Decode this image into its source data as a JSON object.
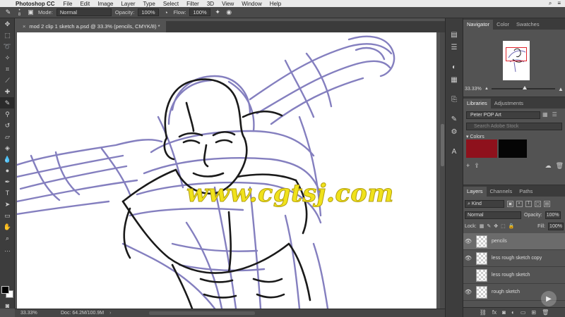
{
  "menubar": {
    "app": "Photoshop CC",
    "items": [
      "File",
      "Edit",
      "Image",
      "Layer",
      "Type",
      "Select",
      "Filter",
      "3D",
      "View",
      "Window",
      "Help"
    ]
  },
  "options": {
    "brush_size": "8",
    "mode_label": "Mode:",
    "mode_value": "Normal",
    "opacity_label": "Opacity:",
    "opacity_value": "100%",
    "flow_label": "Flow:",
    "flow_value": "100%"
  },
  "document": {
    "tab_title": "mod 2 clip 1 sketch a.psd @ 33.3% (pencils, CMYK/8) *",
    "close_glyph": "×",
    "watermark": "www.cgtsj.com"
  },
  "status": {
    "zoom": "33.33%",
    "doc": "Doc: 64.2M/100.9M",
    "arrow": "›"
  },
  "navigator": {
    "tabs": [
      "Navigator",
      "Color",
      "Swatches"
    ],
    "zoom": "33.33%",
    "slider_level": 0.52
  },
  "libraries": {
    "tabs": [
      "Libraries",
      "Adjustments"
    ],
    "library_name": "Peter POP Art",
    "search_placeholder": "Search Adobe Stock",
    "colors_heading": "Colors",
    "swatches": [
      "#8e111c",
      "#050505"
    ]
  },
  "layers": {
    "tabs": [
      "Layers",
      "Channels",
      "Paths"
    ],
    "kind": "Kind",
    "blend_mode": "Normal",
    "opacity_label": "Opacity:",
    "opacity_value": "100%",
    "lock_label": "Lock:",
    "fill_label": "Fill:",
    "fill_value": "100%",
    "items": [
      {
        "name": "pencils",
        "visible": true,
        "selected": true
      },
      {
        "name": "less rough sketch copy",
        "visible": true,
        "selected": false
      },
      {
        "name": "less rough sketch",
        "visible": false,
        "selected": false
      },
      {
        "name": "rough sketch",
        "visible": true,
        "selected": false
      }
    ],
    "footer_fx": "fx"
  },
  "colors": {
    "sketch_blue": "#6f69b4",
    "ink": "#1a1a1a",
    "watermark_yellow": "#f0e21b",
    "nav_highlight": "#e0242c"
  }
}
